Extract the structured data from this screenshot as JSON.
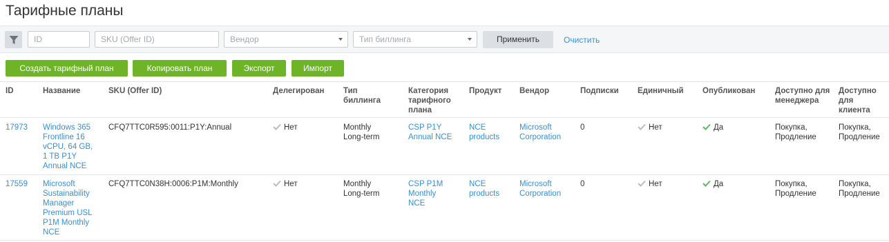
{
  "page": {
    "title": "Тарифные планы"
  },
  "filters": {
    "id_placeholder": "ID",
    "sku_placeholder": "SKU (Offer ID)",
    "vendor_placeholder": "Вендор",
    "billing_placeholder": "Тип биллинга",
    "apply_label": "Применить",
    "clear_label": "Очистить"
  },
  "actions": {
    "create": "Создать тарифный план",
    "copy": "Копировать план",
    "export": "Экспорт",
    "import": "Импорт"
  },
  "columns": {
    "id": "ID",
    "name": "Название",
    "sku": "SKU (Offer ID)",
    "delegated": "Делегирован",
    "billing": "Тип биллинга",
    "category": "Категория тарифного плана",
    "product": "Продукт",
    "vendor": "Вендор",
    "subscriptions": "Подписки",
    "single": "Единичный",
    "published": "Опубликован",
    "manager": "Доступно для менеджера",
    "client": "Доступно для клиента"
  },
  "rows": [
    {
      "id": "17973",
      "name": "Windows 365 Frontline 16 vCPU, 64 GB, 1 TB P1Y Annual NCE",
      "sku": "CFQ7TTC0R595:0011:P1Y:Annual",
      "delegated": "Нет",
      "billing": "Monthly Long-term",
      "category": "CSP P1Y Annual NCE",
      "product": "NCE products",
      "vendor": "Microsoft Corporation",
      "subscriptions": "0",
      "single": "Нет",
      "published": "Да",
      "manager": "Покупка, Продление",
      "client": "Покупка, Продление"
    },
    {
      "id": "17559",
      "name": "Microsoft Sustainability Manager Premium USL P1M Monthly NCE",
      "sku": "CFQ7TTC0N38H:0006:P1M:Monthly",
      "delegated": "Нет",
      "billing": "Monthly Long-term",
      "category": "CSP P1M Monthly NCE",
      "product": "NCE products",
      "vendor": "Microsoft Corporation",
      "subscriptions": "0",
      "single": "Нет",
      "published": "Да",
      "manager": "Покупка, Продление",
      "client": "Покупка, Продление"
    }
  ],
  "colors": {
    "accent_green": "#6db526",
    "link_blue": "#3b8fcf",
    "check_green": "#5cb85c",
    "check_gray": "#b8bcc1"
  }
}
